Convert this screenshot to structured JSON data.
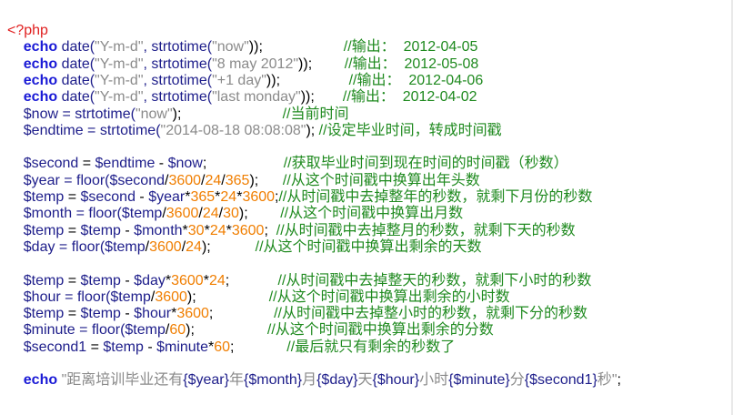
{
  "colors": {
    "background": "#ffffff",
    "keyword": "#1a1ad6",
    "string": "#8a8a8a",
    "number": "#f07e00",
    "comment": "#1f8a1f",
    "variable": "#1d1d8a",
    "tag": "#e02020"
  },
  "code": {
    "lines": [
      [
        {
          "t": "<?php",
          "k": "tag"
        }
      ],
      [
        {
          "t": "    "
        },
        {
          "t": "echo",
          "k": "kw"
        },
        {
          "t": " date(",
          "k": "fn"
        },
        {
          "t": "\"Y-m-d\"",
          "k": "str"
        },
        {
          "t": ", strtotime(",
          "k": "fn"
        },
        {
          "t": "\"now\"",
          "k": "str"
        },
        {
          "t": "));",
          "k": "op"
        },
        {
          "t": "                    "
        },
        {
          "t": "//输出：  2012-04-05",
          "k": "cmt"
        }
      ],
      [
        {
          "t": "    "
        },
        {
          "t": "echo",
          "k": "kw"
        },
        {
          "t": " date(",
          "k": "fn"
        },
        {
          "t": "\"Y-m-d\"",
          "k": "str"
        },
        {
          "t": ", strtotime(",
          "k": "fn"
        },
        {
          "t": "\"8 may 2012\"",
          "k": "str"
        },
        {
          "t": "));",
          "k": "op"
        },
        {
          "t": "        "
        },
        {
          "t": "//输出：  2012-05-08",
          "k": "cmt"
        }
      ],
      [
        {
          "t": "    "
        },
        {
          "t": "echo",
          "k": "kw"
        },
        {
          "t": " date(",
          "k": "fn"
        },
        {
          "t": "\"Y-m-d\"",
          "k": "str"
        },
        {
          "t": ", strtotime(",
          "k": "fn"
        },
        {
          "t": "\"+1 day\"",
          "k": "str"
        },
        {
          "t": "));",
          "k": "op"
        },
        {
          "t": "                 "
        },
        {
          "t": "//输出：  2012-04-06",
          "k": "cmt"
        }
      ],
      [
        {
          "t": "    "
        },
        {
          "t": "echo",
          "k": "kw"
        },
        {
          "t": " date(",
          "k": "fn"
        },
        {
          "t": "\"Y-m-d\"",
          "k": "str"
        },
        {
          "t": ", strtotime(",
          "k": "fn"
        },
        {
          "t": "\"last monday\"",
          "k": "str"
        },
        {
          "t": "));",
          "k": "op"
        },
        {
          "t": "       "
        },
        {
          "t": "//输出：  2012-04-02",
          "k": "cmt"
        }
      ],
      [
        {
          "t": "    "
        },
        {
          "t": "$now",
          "k": "var"
        },
        {
          "t": " = strtotime(",
          "k": "fn"
        },
        {
          "t": "\"now\"",
          "k": "str"
        },
        {
          "t": ");",
          "k": "op"
        },
        {
          "t": "                         "
        },
        {
          "t": "//当前时间",
          "k": "cmt"
        }
      ],
      [
        {
          "t": "    "
        },
        {
          "t": "$endtime",
          "k": "var"
        },
        {
          "t": " = strtotime(",
          "k": "fn"
        },
        {
          "t": "\"2014-08-18 08:08:08\"",
          "k": "str"
        },
        {
          "t": "); ",
          "k": "op"
        },
        {
          "t": "//设定毕业时间，转成时间戳",
          "k": "cmt"
        }
      ],
      [
        {
          "t": ""
        }
      ],
      [
        {
          "t": "    "
        },
        {
          "t": "$second",
          "k": "var"
        },
        {
          "t": " = ",
          "k": "op"
        },
        {
          "t": "$endtime",
          "k": "var"
        },
        {
          "t": " - ",
          "k": "op"
        },
        {
          "t": "$now",
          "k": "var"
        },
        {
          "t": ";",
          "k": "op"
        },
        {
          "t": "                   "
        },
        {
          "t": "//获取毕业时间到现在时间的时间戳（秒数）",
          "k": "cmt"
        }
      ],
      [
        {
          "t": "    "
        },
        {
          "t": "$year",
          "k": "var"
        },
        {
          "t": " = floor(",
          "k": "fn"
        },
        {
          "t": "$second",
          "k": "var"
        },
        {
          "t": "/",
          "k": "op"
        },
        {
          "t": "3600",
          "k": "num"
        },
        {
          "t": "/",
          "k": "op"
        },
        {
          "t": "24",
          "k": "num"
        },
        {
          "t": "/",
          "k": "op"
        },
        {
          "t": "365",
          "k": "num"
        },
        {
          "t": ");",
          "k": "op"
        },
        {
          "t": "      "
        },
        {
          "t": "//从这个时间戳中换算出年头数",
          "k": "cmt"
        }
      ],
      [
        {
          "t": "    "
        },
        {
          "t": "$temp",
          "k": "var"
        },
        {
          "t": " = ",
          "k": "op"
        },
        {
          "t": "$second",
          "k": "var"
        },
        {
          "t": " - ",
          "k": "op"
        },
        {
          "t": "$year",
          "k": "var"
        },
        {
          "t": "*",
          "k": "op"
        },
        {
          "t": "365",
          "k": "num"
        },
        {
          "t": "*",
          "k": "op"
        },
        {
          "t": "24",
          "k": "num"
        },
        {
          "t": "*",
          "k": "op"
        },
        {
          "t": "3600",
          "k": "num"
        },
        {
          "t": ";",
          "k": "op"
        },
        {
          "t": "//从时间戳中去掉整年的秒数，就剩下月份的秒数",
          "k": "cmt"
        }
      ],
      [
        {
          "t": "    "
        },
        {
          "t": "$month",
          "k": "var"
        },
        {
          "t": " = floor(",
          "k": "fn"
        },
        {
          "t": "$temp",
          "k": "var"
        },
        {
          "t": "/",
          "k": "op"
        },
        {
          "t": "3600",
          "k": "num"
        },
        {
          "t": "/",
          "k": "op"
        },
        {
          "t": "24",
          "k": "num"
        },
        {
          "t": "/",
          "k": "op"
        },
        {
          "t": "30",
          "k": "num"
        },
        {
          "t": ");",
          "k": "op"
        },
        {
          "t": "        "
        },
        {
          "t": "//从这个时间戳中换算出月数",
          "k": "cmt"
        }
      ],
      [
        {
          "t": "    "
        },
        {
          "t": "$temp",
          "k": "var"
        },
        {
          "t": " = ",
          "k": "op"
        },
        {
          "t": "$temp",
          "k": "var"
        },
        {
          "t": " - ",
          "k": "op"
        },
        {
          "t": "$month",
          "k": "var"
        },
        {
          "t": "*",
          "k": "op"
        },
        {
          "t": "30",
          "k": "num"
        },
        {
          "t": "*",
          "k": "op"
        },
        {
          "t": "24",
          "k": "num"
        },
        {
          "t": "*",
          "k": "op"
        },
        {
          "t": "3600",
          "k": "num"
        },
        {
          "t": ";",
          "k": "op"
        },
        {
          "t": "  "
        },
        {
          "t": "//从时间戳中去掉整月的秒数，就剩下天的秒数",
          "k": "cmt"
        }
      ],
      [
        {
          "t": "    "
        },
        {
          "t": "$day",
          "k": "var"
        },
        {
          "t": " = floor(",
          "k": "fn"
        },
        {
          "t": "$temp",
          "k": "var"
        },
        {
          "t": "/",
          "k": "op"
        },
        {
          "t": "3600",
          "k": "num"
        },
        {
          "t": "/",
          "k": "op"
        },
        {
          "t": "24",
          "k": "num"
        },
        {
          "t": ");",
          "k": "op"
        },
        {
          "t": "           "
        },
        {
          "t": "//从这个时间戳中换算出剩余的天数",
          "k": "cmt"
        }
      ],
      [
        {
          "t": ""
        }
      ],
      [
        {
          "t": "    "
        },
        {
          "t": "$temp",
          "k": "var"
        },
        {
          "t": " = ",
          "k": "op"
        },
        {
          "t": "$temp",
          "k": "var"
        },
        {
          "t": " - ",
          "k": "op"
        },
        {
          "t": "$day",
          "k": "var"
        },
        {
          "t": "*",
          "k": "op"
        },
        {
          "t": "3600",
          "k": "num"
        },
        {
          "t": "*",
          "k": "op"
        },
        {
          "t": "24",
          "k": "num"
        },
        {
          "t": ";",
          "k": "op"
        },
        {
          "t": "            "
        },
        {
          "t": "//从时间戳中去掉整天的秒数，就剩下小时的秒数",
          "k": "cmt"
        }
      ],
      [
        {
          "t": "    "
        },
        {
          "t": "$hour",
          "k": "var"
        },
        {
          "t": " = floor(",
          "k": "fn"
        },
        {
          "t": "$temp",
          "k": "var"
        },
        {
          "t": "/",
          "k": "op"
        },
        {
          "t": "3600",
          "k": "num"
        },
        {
          "t": ");",
          "k": "op"
        },
        {
          "t": "                  "
        },
        {
          "t": "//从这个时间戳中换算出剩余的小时数",
          "k": "cmt"
        }
      ],
      [
        {
          "t": "    "
        },
        {
          "t": "$temp",
          "k": "var"
        },
        {
          "t": " = ",
          "k": "op"
        },
        {
          "t": "$temp",
          "k": "var"
        },
        {
          "t": " - ",
          "k": "op"
        },
        {
          "t": "$hour",
          "k": "var"
        },
        {
          "t": "*",
          "k": "op"
        },
        {
          "t": "3600",
          "k": "num"
        },
        {
          "t": ";",
          "k": "op"
        },
        {
          "t": "               "
        },
        {
          "t": "//从时间戳中去掉整小时的秒数，就剩下分的秒数",
          "k": "cmt"
        }
      ],
      [
        {
          "t": "    "
        },
        {
          "t": "$minute",
          "k": "var"
        },
        {
          "t": " = floor(",
          "k": "fn"
        },
        {
          "t": "$temp",
          "k": "var"
        },
        {
          "t": "/",
          "k": "op"
        },
        {
          "t": "60",
          "k": "num"
        },
        {
          "t": ");",
          "k": "op"
        },
        {
          "t": "                  "
        },
        {
          "t": "//从这个时间戳中换算出剩余的分数",
          "k": "cmt"
        }
      ],
      [
        {
          "t": "    "
        },
        {
          "t": "$second1",
          "k": "var"
        },
        {
          "t": " = ",
          "k": "op"
        },
        {
          "t": "$temp",
          "k": "var"
        },
        {
          "t": " - ",
          "k": "op"
        },
        {
          "t": "$minute",
          "k": "var"
        },
        {
          "t": "*",
          "k": "op"
        },
        {
          "t": "60",
          "k": "num"
        },
        {
          "t": ";",
          "k": "op"
        },
        {
          "t": "             "
        },
        {
          "t": "//最后就只有剩余的秒数了",
          "k": "cmt"
        }
      ],
      [
        {
          "t": ""
        }
      ],
      [
        {
          "t": "    "
        },
        {
          "t": "echo",
          "k": "kw"
        },
        {
          "t": " ",
          "k": "op"
        },
        {
          "t": "\"距离培训毕业还有",
          "k": "str"
        },
        {
          "t": "{$year}",
          "k": "var"
        },
        {
          "t": "年",
          "k": "str"
        },
        {
          "t": "{$month}",
          "k": "var"
        },
        {
          "t": "月",
          "k": "str"
        },
        {
          "t": "{$day}",
          "k": "var"
        },
        {
          "t": "天",
          "k": "str"
        },
        {
          "t": "{$hour}",
          "k": "var"
        },
        {
          "t": "小时",
          "k": "str"
        },
        {
          "t": "{$minute}",
          "k": "var"
        },
        {
          "t": "分",
          "k": "str"
        },
        {
          "t": "{$second1}",
          "k": "var"
        },
        {
          "t": "秒\"",
          "k": "str"
        },
        {
          "t": ";",
          "k": "op"
        }
      ]
    ]
  }
}
